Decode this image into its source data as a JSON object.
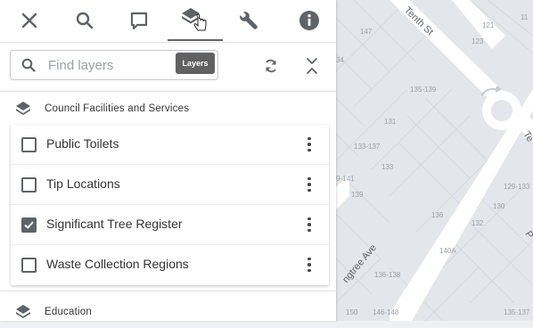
{
  "toolbar": {
    "items": [
      {
        "icon": "close-icon"
      },
      {
        "icon": "search-icon"
      },
      {
        "icon": "comment-icon"
      },
      {
        "icon": "layers-icon",
        "active": true
      },
      {
        "icon": "wrench-icon"
      },
      {
        "icon": "info-icon"
      }
    ]
  },
  "search": {
    "placeholder": "Find layers",
    "value": "",
    "tooltip": "Layers"
  },
  "groups": [
    {
      "title": "Council Facilities and Services",
      "layers": [
        {
          "label": "Public Toilets",
          "checked": false
        },
        {
          "label": "Tip Locations",
          "checked": false
        },
        {
          "label": "Significant Tree Register",
          "checked": true
        },
        {
          "label": "Waste Collection Regions",
          "checked": false
        }
      ]
    },
    {
      "title": "Education",
      "layers": []
    }
  ],
  "map": {
    "streets": [
      "Tenth St",
      "ngtree Ave",
      "Te",
      "P"
    ],
    "lot_numbers": [
      "147",
      "121",
      "123",
      "11",
      "34",
      "135-139",
      "131",
      "133-137",
      "133",
      "9-141",
      "139",
      "129-133",
      "130",
      "136",
      "132",
      "140A",
      "136-138",
      "150",
      "146-148",
      "135-137"
    ]
  },
  "colors": {
    "accent": "#5f6368",
    "tooltip_bg": "#616161",
    "map_bg": "#e6e8ec",
    "road": "#ffffff"
  }
}
